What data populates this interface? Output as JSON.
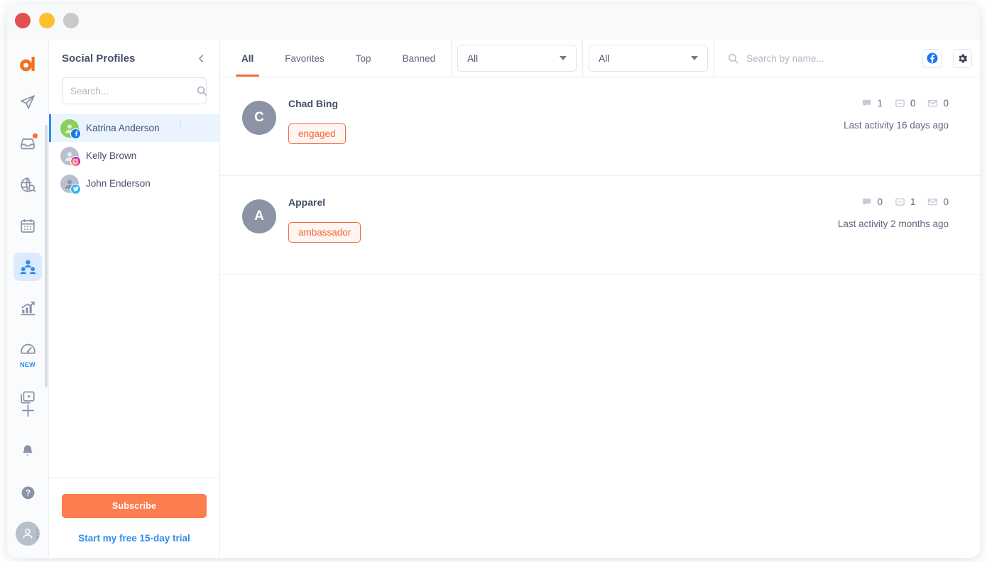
{
  "window": {
    "traffic_lights": [
      "close",
      "minimize",
      "maximize"
    ],
    "colors": {
      "red": "#e0504f",
      "yellow": "#fcc02d",
      "gray": "#c9c9c9"
    }
  },
  "accent": {
    "orange": "#ff6a33",
    "blue": "#2f8ded",
    "tag_orange": "#f2683c"
  },
  "rail": {
    "logo": "brand-logo-a",
    "items": [
      {
        "name": "send-icon",
        "icon": "paper-plane",
        "active": false,
        "notification": false
      },
      {
        "name": "inbox-icon",
        "icon": "inbox",
        "active": false,
        "notification": true
      },
      {
        "name": "monitoring-icon",
        "icon": "globe-search",
        "active": false,
        "notification": false
      },
      {
        "name": "calendar-icon",
        "icon": "calendar",
        "active": false,
        "notification": false
      },
      {
        "name": "social-profiles-icon",
        "icon": "users",
        "active": true,
        "notification": false
      },
      {
        "name": "analytics-icon",
        "icon": "bar-chart-up",
        "active": false,
        "notification": false
      },
      {
        "name": "performance-icon",
        "icon": "speedometer",
        "active": false,
        "notification": false,
        "tag": "NEW"
      },
      {
        "name": "media-library-icon",
        "icon": "folder-play",
        "active": false,
        "notification": false
      }
    ],
    "bottom_items": [
      {
        "name": "add-icon",
        "icon": "plus"
      },
      {
        "name": "notifications-icon",
        "icon": "bell"
      },
      {
        "name": "help-icon",
        "icon": "question-circle"
      },
      {
        "name": "account-avatar",
        "icon": "person"
      }
    ]
  },
  "panel": {
    "title": "Social Profiles",
    "collapse_icon": "chevron-left-icon",
    "search": {
      "placeholder": "Search...",
      "value": "",
      "icon": "search-icon"
    },
    "profiles": [
      {
        "name": "Katrina Anderson",
        "network": "facebook",
        "avatar_color": "green",
        "selected": true
      },
      {
        "name": "Kelly Brown",
        "network": "instagram",
        "avatar_color": "gray",
        "selected": false
      },
      {
        "name": "John Enderson",
        "network": "twitter",
        "avatar_color": "gray",
        "selected": false
      }
    ],
    "footer": {
      "subscribe_label": "Subscribe",
      "trial_label": "Start my free 15-day trial"
    }
  },
  "toolbar": {
    "tabs": [
      {
        "label": "All",
        "active": true
      },
      {
        "label": "Favorites",
        "active": false
      },
      {
        "label": "Top",
        "active": false
      },
      {
        "label": "Banned",
        "active": false
      }
    ],
    "filters": [
      {
        "name": "network-filter",
        "value": "All"
      },
      {
        "name": "type-filter",
        "value": "All"
      }
    ],
    "search": {
      "placeholder": "Search by name...",
      "value": "",
      "icon": "search-icon"
    },
    "actions": [
      {
        "name": "facebook-filter-button",
        "icon": "facebook-icon"
      },
      {
        "name": "settings-button",
        "icon": "gear-icon"
      }
    ]
  },
  "contacts": [
    {
      "initial": "C",
      "name": "Chad Bing",
      "tag": "engaged",
      "metrics": [
        {
          "icon": "comment-icon",
          "value": "1"
        },
        {
          "icon": "post-icon",
          "value": "0"
        },
        {
          "icon": "message-icon",
          "value": "0"
        }
      ],
      "last_activity": "Last activity 16 days ago"
    },
    {
      "initial": "A",
      "name": "Apparel",
      "tag": "ambassador",
      "metrics": [
        {
          "icon": "comment-icon",
          "value": "0"
        },
        {
          "icon": "post-icon",
          "value": "1"
        },
        {
          "icon": "message-icon",
          "value": "0"
        }
      ],
      "last_activity": "Last activity 2 months ago"
    }
  ]
}
